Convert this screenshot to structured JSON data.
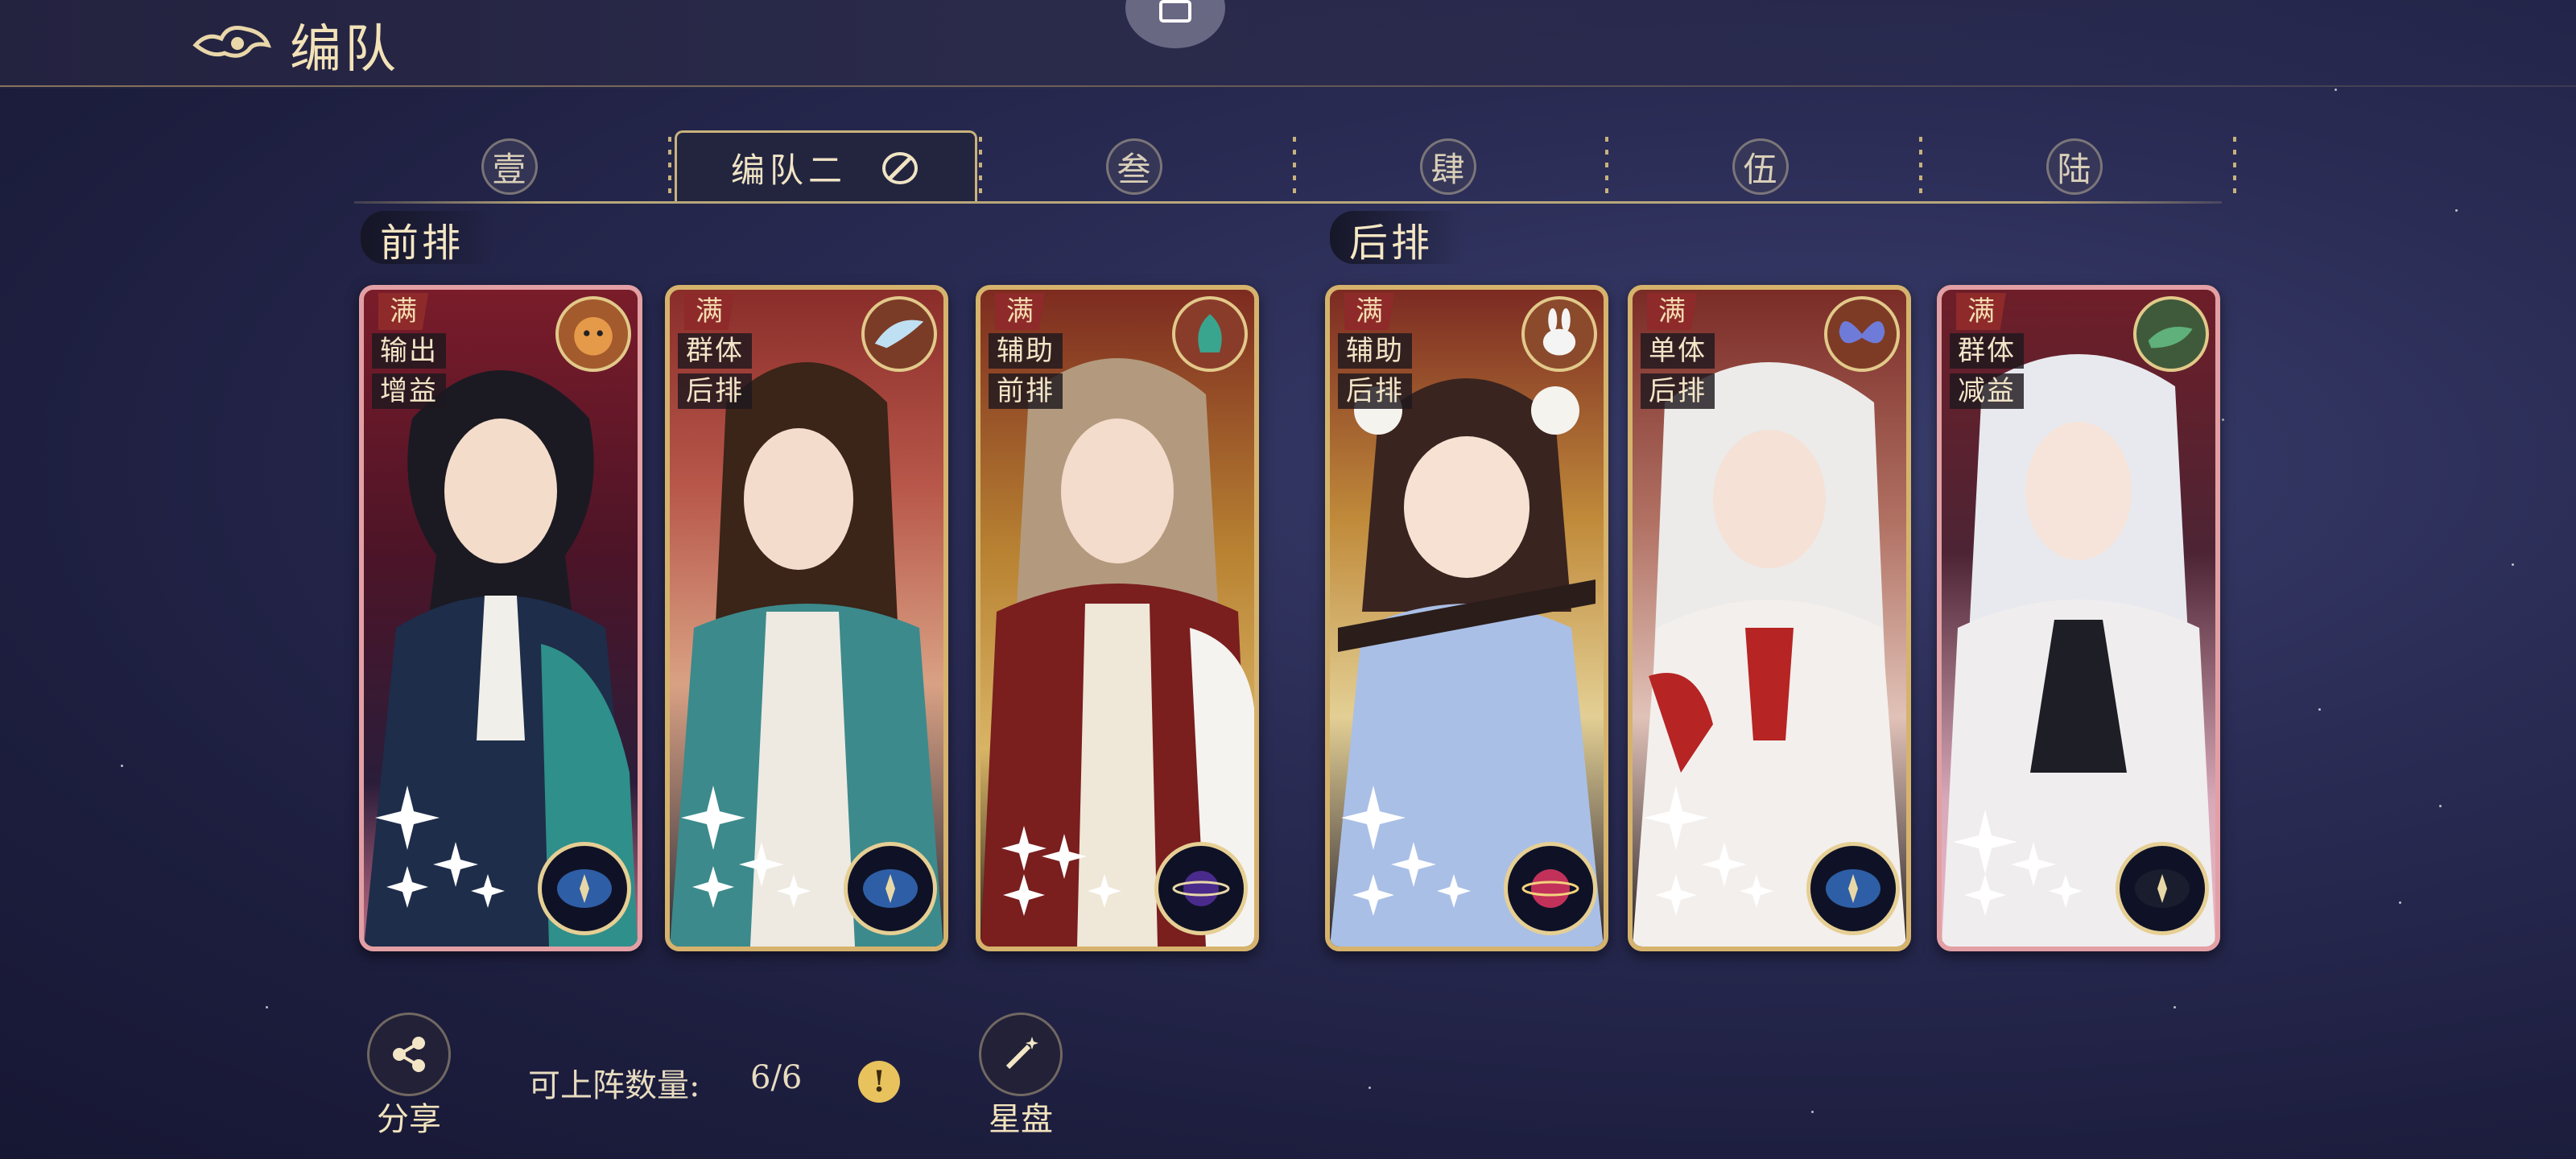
{
  "header": {
    "title": "编队"
  },
  "tabs": [
    {
      "label": "壹",
      "active": false
    },
    {
      "label": "编队二",
      "active": true
    },
    {
      "label": "叁",
      "active": false
    },
    {
      "label": "肆",
      "active": false
    },
    {
      "label": "伍",
      "active": false
    },
    {
      "label": "陆",
      "active": false
    }
  ],
  "rows": {
    "front": "前排",
    "back": "后排"
  },
  "cards": [
    {
      "full": "满",
      "role1": "输出",
      "role2": "增益",
      "pet": "fox-pet",
      "emblem": "compass-emblem"
    },
    {
      "full": "满",
      "role1": "群体",
      "role2": "后排",
      "pet": "bird-pet",
      "emblem": "compass-emblem"
    },
    {
      "full": "满",
      "role1": "辅助",
      "role2": "前排",
      "pet": "phoenix-pet",
      "emblem": "planet-emblem"
    },
    {
      "full": "满",
      "role1": "辅助",
      "role2": "后排",
      "pet": "rabbit-pet",
      "emblem": "planet-emblem"
    },
    {
      "full": "满",
      "role1": "单体",
      "role2": "后排",
      "pet": "butterfly-pet",
      "emblem": "compass-emblem"
    },
    {
      "full": "满",
      "role1": "群体",
      "role2": "减益",
      "pet": "lizard-pet",
      "emblem": "compass-emblem"
    }
  ],
  "footer": {
    "share_label": "分享",
    "count_label": "可上阵数量:",
    "count_value": "6/6",
    "info_badge": "!",
    "starmap_label": "星盘"
  }
}
